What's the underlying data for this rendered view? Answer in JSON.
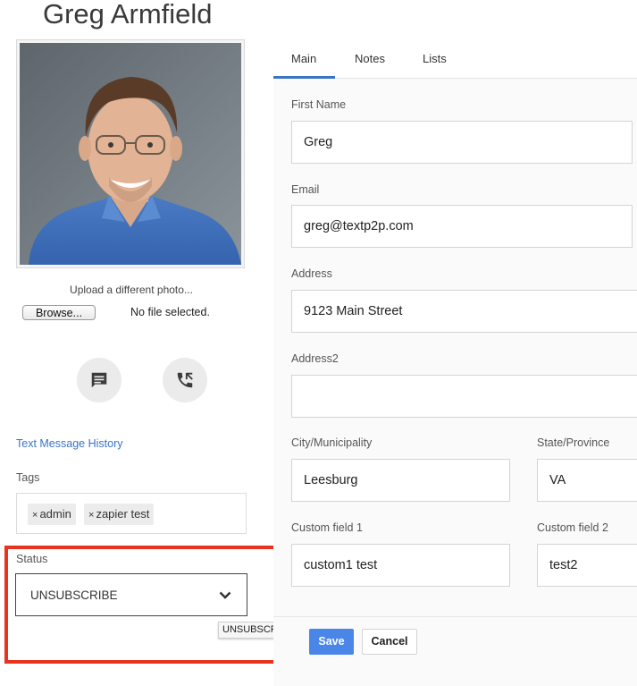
{
  "contact": {
    "name": "Greg Armfield"
  },
  "photo": {
    "upload_label": "Upload a different photo...",
    "browse_label": "Browse...",
    "file_status": "No file selected."
  },
  "actions": {
    "message_icon": "chat-bubble-icon",
    "call_icon": "phone-call-icon"
  },
  "history_link": "Text Message History",
  "tags": {
    "label": "Tags",
    "items": [
      {
        "text": "admin"
      },
      {
        "text": "zapier test"
      }
    ],
    "remove_glyph": "×"
  },
  "status": {
    "label": "Status",
    "value": "UNSUBSCRIBE",
    "tooltip": "UNSUBSCRIBE"
  },
  "tabs": [
    {
      "label": "Main",
      "active": true
    },
    {
      "label": "Notes"
    },
    {
      "label": "Lists"
    }
  ],
  "form": {
    "first_name": {
      "label": "First Name",
      "value": "Greg"
    },
    "email": {
      "label": "Email",
      "value": "greg@textp2p.com"
    },
    "address": {
      "label": "Address",
      "value": "9123 Main Street"
    },
    "address2": {
      "label": "Address2",
      "value": ""
    },
    "city": {
      "label": "City/Municipality",
      "value": "Leesburg"
    },
    "state": {
      "label": "State/Province",
      "value": "VA"
    },
    "custom1": {
      "label": "Custom field 1",
      "value": "custom1 test"
    },
    "custom2": {
      "label": "Custom field 2",
      "value": "test2"
    }
  },
  "buttons": {
    "save": "Save",
    "cancel": "Cancel"
  },
  "colors": {
    "accent": "#3a74c5",
    "save": "#4a86e8",
    "highlight": "#e8331e"
  }
}
